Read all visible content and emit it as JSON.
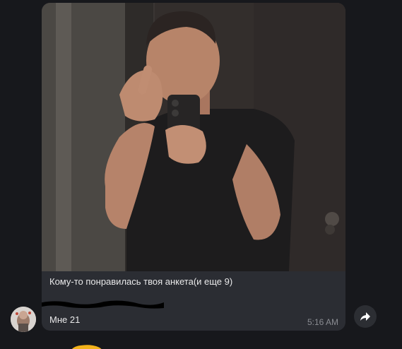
{
  "message": {
    "caption_line1": "Кому-то понравилась твоя анкета(и еще 9)",
    "caption_line3": "Мне 21",
    "time": "5:16 AM"
  },
  "icons": {
    "share": "forward-arrow-icon",
    "avatar": "user-avatar"
  },
  "colors": {
    "background": "#17181c",
    "bubble": "#2b2d33",
    "text": "#e9e9ea",
    "time": "#8a8c92"
  }
}
